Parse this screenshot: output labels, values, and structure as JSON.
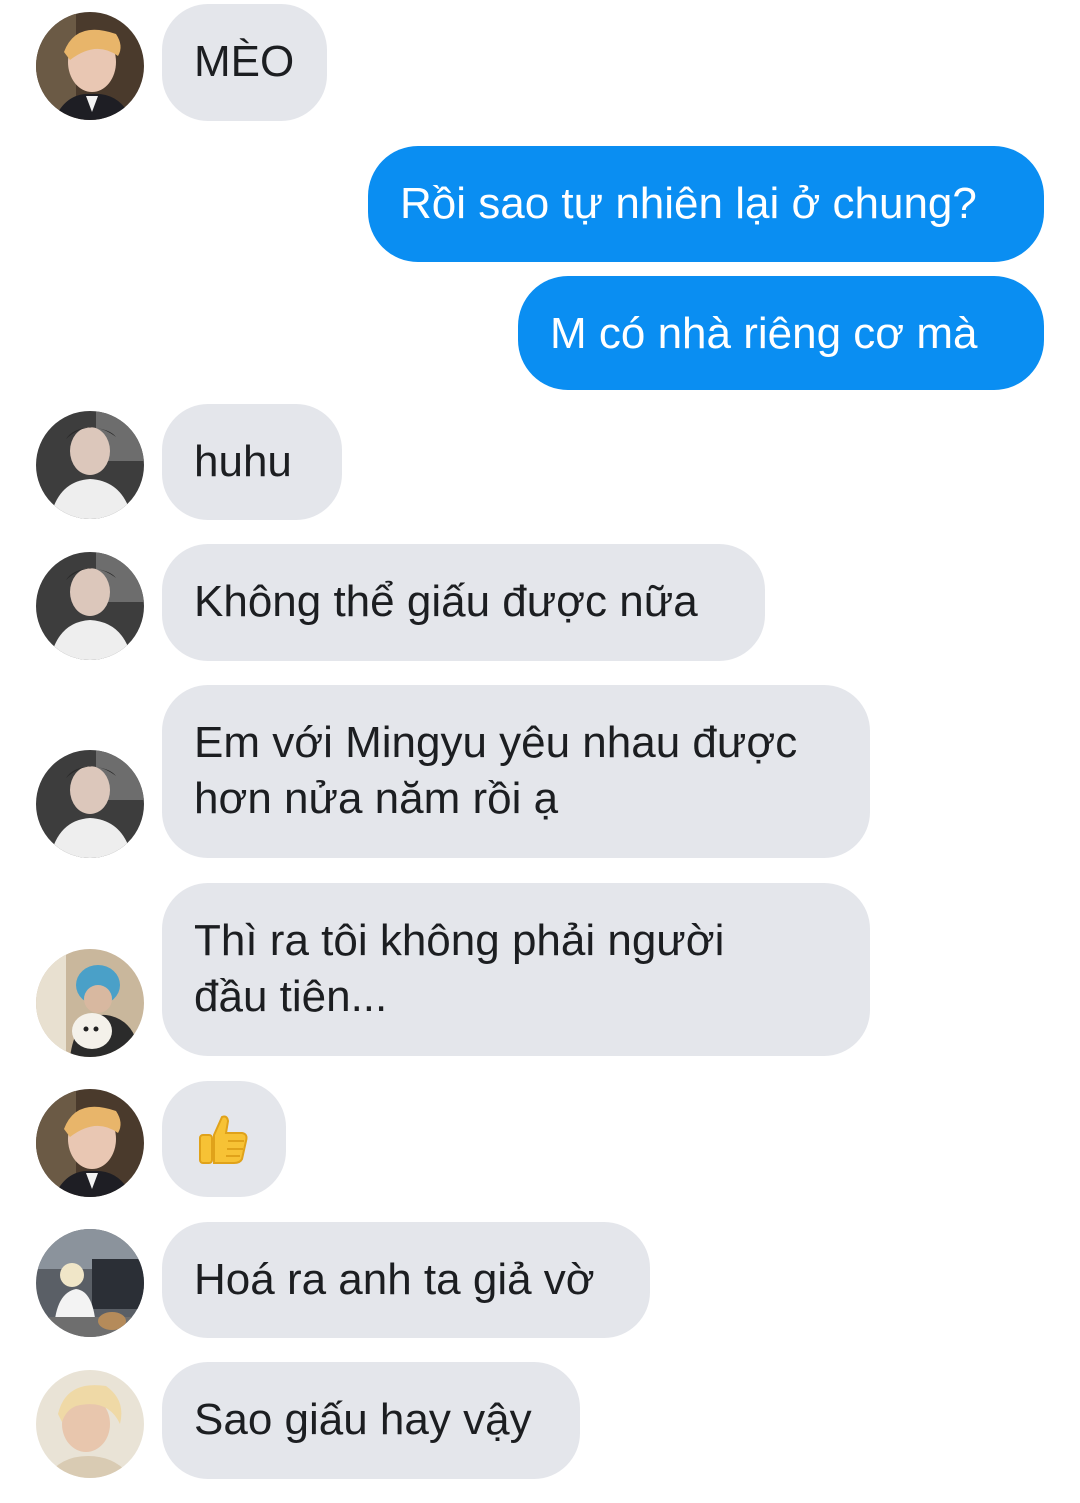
{
  "messages": [
    {
      "from": "them",
      "text": "MÈO"
    },
    {
      "from": "me",
      "text": "Rồi sao tự nhiên lại ở chung?"
    },
    {
      "from": "me",
      "text": "M có nhà riêng cơ mà"
    },
    {
      "from": "them",
      "text": "huhu"
    },
    {
      "from": "them",
      "text": "Không thể giấu được nữa"
    },
    {
      "from": "them",
      "lines": [
        "Em với Mingyu yêu nhau được",
        "hơn nửa năm rồi ạ"
      ]
    },
    {
      "from": "them",
      "lines": [
        "Thì ra tôi không phải người",
        "đầu tiên..."
      ]
    },
    {
      "from": "them",
      "text": "👍",
      "icon": "thumbs-up-icon"
    },
    {
      "from": "them",
      "text": "Hoá ra anh ta giả vờ"
    },
    {
      "from": "them",
      "text": "Sao giấu hay vậy"
    }
  ],
  "colors": {
    "incoming_bubble": "#e4e6eb",
    "outgoing_bubble": "#0a8ef2",
    "incoming_text": "#1c1e21",
    "outgoing_text": "#ffffff"
  }
}
